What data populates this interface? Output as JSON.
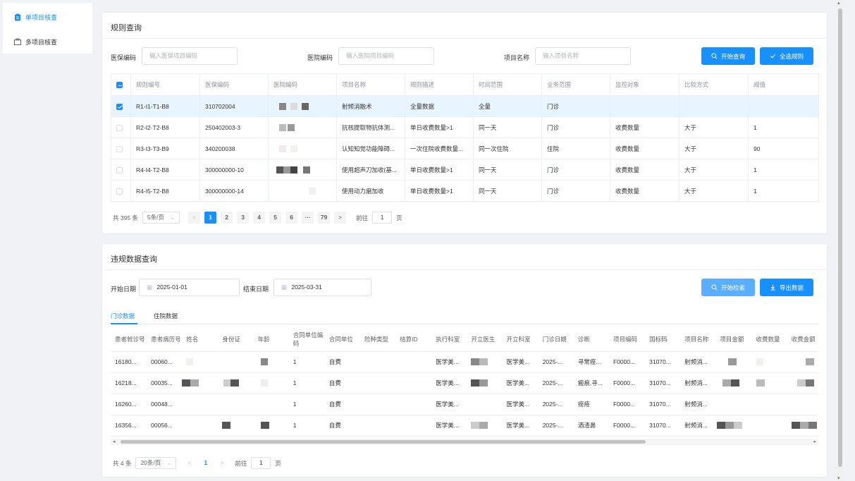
{
  "sidebar": {
    "items": [
      {
        "label": "单项目核查",
        "active": true
      },
      {
        "label": "多项目核查",
        "active": false
      }
    ]
  },
  "rule_query": {
    "title": "规则查询",
    "fields": [
      {
        "label": "医保编码",
        "placeholder": "输入医保项目编码"
      },
      {
        "label": "医院编码",
        "placeholder": "输入医院项目编码"
      },
      {
        "label": "项目名称",
        "placeholder": "输入项目名称"
      }
    ],
    "search_button": "开始查询",
    "select_all_button": "全选规则",
    "columns": [
      "规则编号",
      "医保编码",
      "医院编码",
      "项目名称",
      "规则描述",
      "时间范围",
      "业务范围",
      "监控对象",
      "比较方式",
      "阈值"
    ],
    "rows": [
      {
        "checked": true,
        "cells": [
          "R1-I1-T1-B8",
          "310702004",
          "",
          "射频消融术",
          "全量数据",
          "全量",
          "门诊",
          "",
          "",
          ""
        ]
      },
      {
        "checked": false,
        "cells": [
          "R2-I2-T2-B8",
          "250402003-3",
          "",
          "抗核提取物抗体测...",
          "单日收费数量>1",
          "同一天",
          "门诊",
          "收费数量",
          "大于",
          "1"
        ]
      },
      {
        "checked": false,
        "cells": [
          "R3-I3-T3-B9",
          "340200038",
          "",
          "认知知觉功能障碍...",
          "一次住院收费数量...",
          "同一次住院",
          "住院",
          "收费数量",
          "大于",
          "90"
        ]
      },
      {
        "checked": false,
        "cells": [
          "R4-I4-T2-B8",
          "300000000-10",
          "",
          "使用超声刀加收(基...",
          "单日收费数量>1",
          "同一天",
          "门诊",
          "收费数量",
          "大于",
          "1"
        ]
      },
      {
        "checked": false,
        "cells": [
          "R4-I5-T2-B8",
          "300000000-14",
          "",
          "使用动力磨加收",
          "单日收费数量>1",
          "同一天",
          "门诊",
          "收费数量",
          "大于",
          "1"
        ]
      }
    ],
    "pagination": {
      "total": "共 395 条",
      "page_size": "5条/页",
      "pages": [
        "1",
        "2",
        "3",
        "4",
        "5",
        "6",
        "···",
        "79"
      ],
      "goto_label": "前往",
      "goto_value": "1",
      "page_suffix": "页"
    }
  },
  "violation_query": {
    "title": "违规数据查询",
    "start_label": "开始日期",
    "start_value": "2025-01-01",
    "end_label": "结束日期",
    "end_value": "2025-03-31",
    "search_button": "开始检索",
    "export_button": "导出数据",
    "tabs": [
      "门诊数据",
      "住院数据"
    ],
    "columns": [
      "患者就诊号",
      "患者病历号",
      "姓名",
      "身份证",
      "年龄",
      "合同单位编码",
      "合同单位",
      "险种类型",
      "结算ID",
      "执行科室",
      "开立医生",
      "开立科室",
      "门诊日期",
      "诊断",
      "项目编码",
      "国标码",
      "项目名称",
      "项目金额",
      "收费数量",
      "收费金额"
    ],
    "rows": [
      [
        "16180...",
        "00060...",
        "",
        "",
        "",
        "1",
        "自费",
        "",
        "",
        "医学美...",
        "",
        "医学美...",
        "2025-...",
        "寻常痤...",
        "F0000...",
        "31070...",
        "射频消...",
        "",
        "",
        ""
      ],
      [
        "16218...",
        "00035...",
        "",
        "",
        "",
        "1",
        "自费",
        "",
        "",
        "医学美...",
        "",
        "医学美...",
        "2025-...",
        "瘢痕,寻...",
        "F0000...",
        "31070...",
        "射频消...",
        "",
        "",
        ""
      ],
      [
        "16260...",
        "00048...",
        "",
        "",
        "",
        "1",
        "自费",
        "",
        "",
        "医学美...",
        "",
        "医学美...",
        "2025-...",
        "痤疮",
        "F0000...",
        "31070...",
        "射频消...",
        "",
        "",
        ""
      ],
      [
        "16356...",
        "00056...",
        "",
        "",
        "",
        "1",
        "自费",
        "",
        "",
        "医学美...",
        "",
        "医学美...",
        "2025-...",
        "酒渣鼻",
        "F0000...",
        "31070...",
        "射频消...",
        "",
        "",
        ""
      ]
    ],
    "pagination": {
      "total": "共 4 条",
      "page_size": "20条/页",
      "page": "1",
      "goto_label": "前往",
      "goto_value": "1",
      "page_suffix": "页"
    }
  },
  "colors": {
    "primary": "#1890ff",
    "primary_light": "#5aadff",
    "selected_row": "#e8f4ff"
  }
}
